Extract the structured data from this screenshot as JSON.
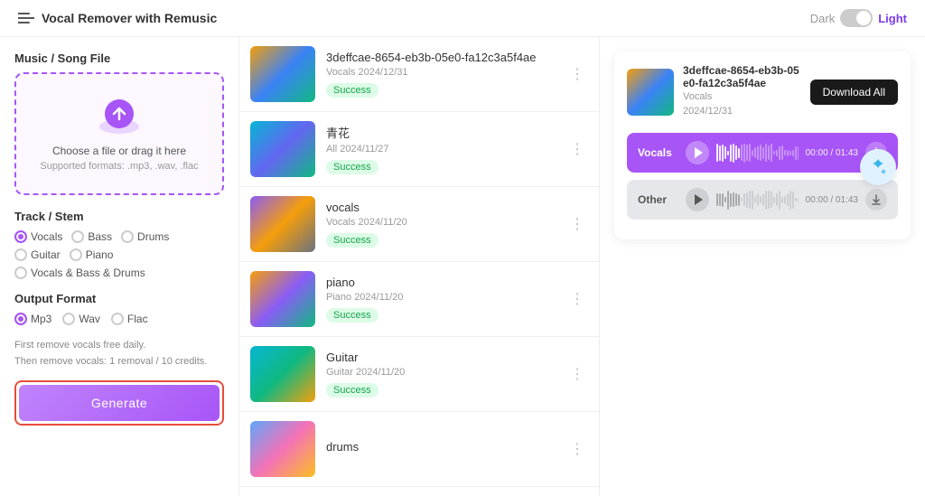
{
  "header": {
    "logo_text": "Vocal Remover with Remusic",
    "dark_label": "Dark",
    "light_label": "Light"
  },
  "left_panel": {
    "music_section_title": "Music / Song File",
    "upload_main": "Choose a file or drag it here",
    "upload_sub": "Supported formats: .mp3, .wav, .flac",
    "track_section_title": "Track / Stem",
    "tracks": [
      {
        "label": "Vocals",
        "active": true
      },
      {
        "label": "Bass",
        "active": false
      },
      {
        "label": "Drums",
        "active": false
      },
      {
        "label": "Guitar",
        "active": false
      },
      {
        "label": "Piano",
        "active": false
      },
      {
        "label": "Vocals & Bass & Drums",
        "active": false
      }
    ],
    "output_section_title": "Output Format",
    "formats": [
      {
        "label": "Mp3",
        "active": true
      },
      {
        "label": "Wav",
        "active": false
      },
      {
        "label": "Flac",
        "active": false
      }
    ],
    "credits_line1": "First remove vocals free daily.",
    "credits_line2": "Then remove vocals: 1 removal / 10 credits.",
    "generate_label": "Generate"
  },
  "song_list": [
    {
      "id": "1",
      "title": "3deffcae-8654-eb3b-05e0-fa12c3a5f4ae",
      "meta": "Vocals  2024/12/31",
      "status": "Success",
      "thumb_class": "thumb-1"
    },
    {
      "id": "2",
      "title": "青花",
      "meta": "All  2024/11/27",
      "status": "Success",
      "thumb_class": "thumb-2"
    },
    {
      "id": "3",
      "title": "vocals",
      "meta": "Vocals  2024/11/20",
      "status": "Success",
      "thumb_class": "thumb-3"
    },
    {
      "id": "4",
      "title": "piano",
      "meta": "Piano  2024/11/20",
      "status": "Success",
      "thumb_class": "thumb-4"
    },
    {
      "id": "5",
      "title": "Guitar",
      "meta": "Guitar  2024/11/20",
      "status": "Success",
      "thumb_class": "thumb-5"
    },
    {
      "id": "6",
      "title": "drums",
      "meta": "",
      "status": "",
      "thumb_class": "thumb-6"
    }
  ],
  "player": {
    "title": "3deffcae-8654-eb3b-05e0-fa12c3a5f4ae",
    "sub_label": "Vocals",
    "date": "2024/12/31",
    "download_all_label": "Download All",
    "vocals_label": "Vocals",
    "other_label": "Other",
    "vocals_time": "00:00 / 01:43",
    "other_time": "00:00 / 01:43"
  }
}
